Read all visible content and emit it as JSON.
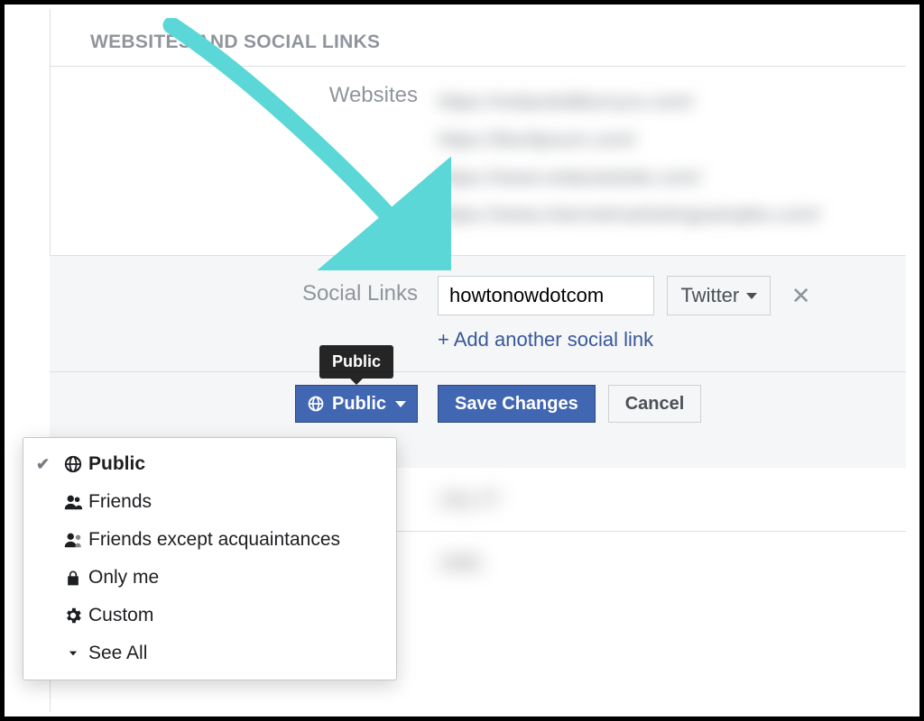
{
  "section_title": "WEBSITES AND SOCIAL LINKS",
  "websites": {
    "label": "Websites"
  },
  "social": {
    "label": "Social Links",
    "input_value": "howtonowdotcom",
    "platform_label": "Twitter",
    "add_more_label": "+ Add another social link"
  },
  "privacy": {
    "button_label": "Public",
    "tooltip": "Public",
    "menu": [
      {
        "label": "Public",
        "icon": "globe",
        "selected": true
      },
      {
        "label": "Friends",
        "icon": "friends",
        "selected": false
      },
      {
        "label": "Friends except acquaintances",
        "icon": "friends-except",
        "selected": false
      },
      {
        "label": "Only me",
        "icon": "lock",
        "selected": false
      },
      {
        "label": "Custom",
        "icon": "gear",
        "selected": false
      },
      {
        "label": "See All",
        "icon": "caret-down",
        "selected": false
      }
    ]
  },
  "actions": {
    "save": "Save Changes",
    "cancel": "Cancel"
  },
  "colors": {
    "fb_blue": "#4267b2",
    "annotation_cyan": "#5bd7d7"
  }
}
